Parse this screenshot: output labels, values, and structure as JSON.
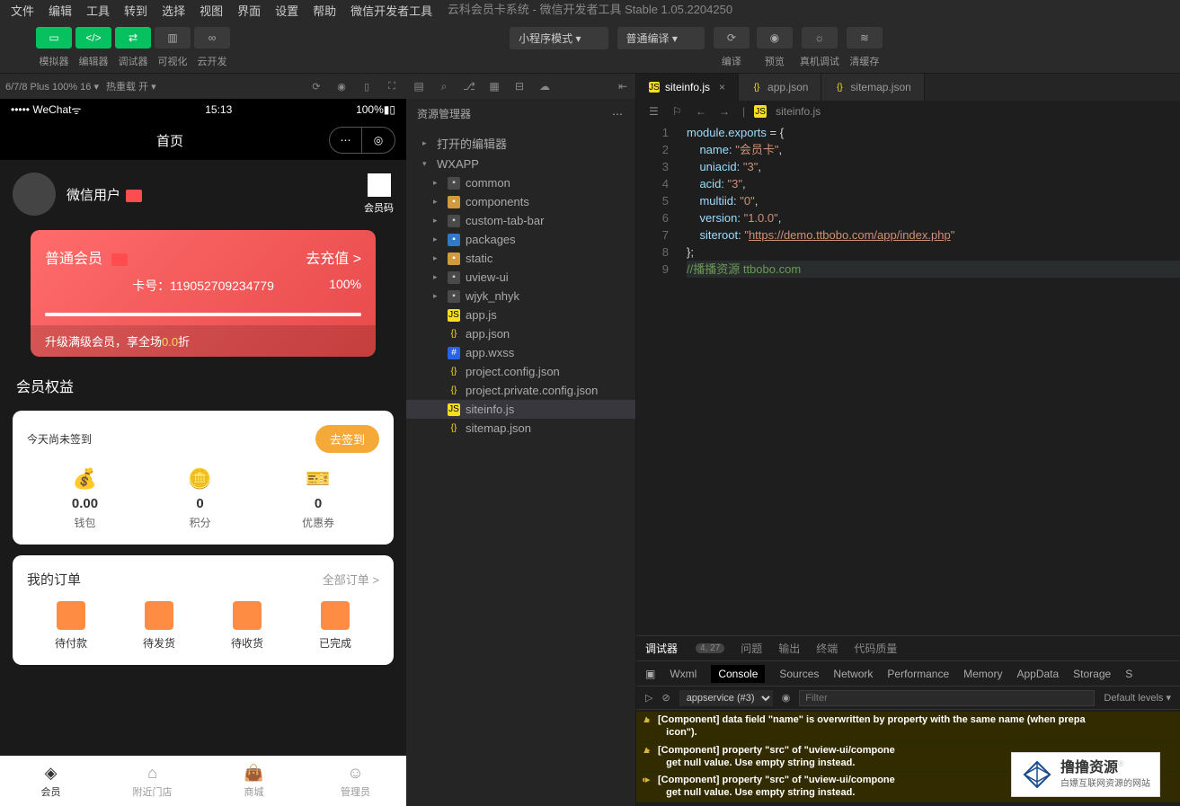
{
  "title": "云科会员卡系统 - 微信开发者工具 Stable 1.05.2204250",
  "menubar": [
    "文件",
    "编辑",
    "工具",
    "转到",
    "选择",
    "视图",
    "界面",
    "设置",
    "帮助",
    "微信开发者工具"
  ],
  "toolbar": {
    "left_labels": [
      "模拟器",
      "编辑器",
      "调试器",
      "可视化",
      "云开发"
    ],
    "mode_select": "小程序模式",
    "compile_select": "普通编译",
    "actions": [
      "编译",
      "预览",
      "真机调试",
      "清缓存"
    ]
  },
  "sim_toolbar": {
    "device": "6/7/8 Plus 100% 16 ▾",
    "hot": "热重载 开 ▾"
  },
  "phone": {
    "carrier": "••••• WeChat",
    "wifi": "ᯤ",
    "time": "15:13",
    "battery": "100%",
    "nav_title": "首页",
    "user": {
      "name": "微信用户",
      "qr_label": "会员码"
    },
    "card": {
      "level": "普通会员",
      "recharge": "去充值 >",
      "num_label": "卡号：",
      "num": "119052709234779",
      "percent": "100%",
      "tip_pre": "升级满级会员，享全场",
      "tip_num": "0.0",
      "tip_suf": "折"
    },
    "rights": "会员权益",
    "signin": {
      "text": "今天尚未签到",
      "btn": "去签到"
    },
    "stats": [
      {
        "val": "0.00",
        "lbl": "钱包"
      },
      {
        "val": "0",
        "lbl": "积分"
      },
      {
        "val": "0",
        "lbl": "优惠券"
      }
    ],
    "orders": {
      "title": "我的订单",
      "more": "全部订单 >",
      "items": [
        "待付款",
        "待发货",
        "待收货",
        "已完成"
      ]
    },
    "tabs": [
      {
        "lbl": "会员"
      },
      {
        "lbl": "附近门店"
      },
      {
        "lbl": "商城"
      },
      {
        "lbl": "管理员"
      }
    ]
  },
  "explorer": {
    "title": "资源管理器",
    "dots": "⋯",
    "open_editors": "打开的编辑器",
    "root": "WXAPP",
    "folders": [
      "common",
      "components",
      "custom-tab-bar",
      "packages",
      "static",
      "uview-ui",
      "wjyk_nhyk"
    ],
    "files": [
      "app.js",
      "app.json",
      "app.wxss",
      "project.config.json",
      "project.private.config.json",
      "siteinfo.js",
      "sitemap.json"
    ]
  },
  "editor": {
    "tabs": [
      {
        "name": "siteinfo.js",
        "icon": "js",
        "active": true
      },
      {
        "name": "app.json",
        "icon": "json"
      },
      {
        "name": "sitemap.json",
        "icon": "json"
      }
    ],
    "breadcrumb": "siteinfo.js",
    "code": {
      "l1_a": "module",
      "l1_b": ".",
      "l1_c": "exports",
      "l1_d": " = {",
      "l2_a": "    name: ",
      "l2_b": "\"会员卡\"",
      "l2_c": ",",
      "l3_a": "    uniacid: ",
      "l3_b": "\"3\"",
      "l3_c": ",",
      "l4_a": "    acid: ",
      "l4_b": "\"3\"",
      "l4_c": ",",
      "l5_a": "    multiid: ",
      "l5_b": "\"0\"",
      "l5_c": ",",
      "l6_a": "    version: ",
      "l6_b": "\"1.0.0\"",
      "l6_c": ",",
      "l7_a": "    siteroot: ",
      "l7_b": "\"",
      "l7_c": "https://demo.ttbobo.com/app/index.php",
      "l7_d": "\"",
      "l8": "};",
      "l9": "//播播资源 ttbobo.com"
    },
    "lines": [
      "1",
      "2",
      "3",
      "4",
      "5",
      "6",
      "7",
      "8",
      "9"
    ]
  },
  "bottom": {
    "tabs": [
      "调试器",
      "问题",
      "输出",
      "终端",
      "代码质量"
    ],
    "count": "4, 27",
    "devtabs": [
      "Wxml",
      "Console",
      "Sources",
      "Network",
      "Performance",
      "Memory",
      "AppData",
      "Storage",
      "S"
    ],
    "context": "appservice (#3)",
    "filter": "Filter",
    "levels": "Default levels ▾",
    "log1": "[Component] data field \"name\" is overwritten by property with the same name (when prepa",
    "log1b": "icon\").",
    "log2": "[Component] property \"src\" of \"uview-ui/compone",
    "log2b": "get null value. Use empty string instead.",
    "log3": "[Component] property \"src\" of \"uview-ui/compone",
    "log3b": "get null value. Use empty string instead."
  },
  "watermark": {
    "big": "撸撸资源",
    "small": "白嫖互联网资源的网站"
  }
}
